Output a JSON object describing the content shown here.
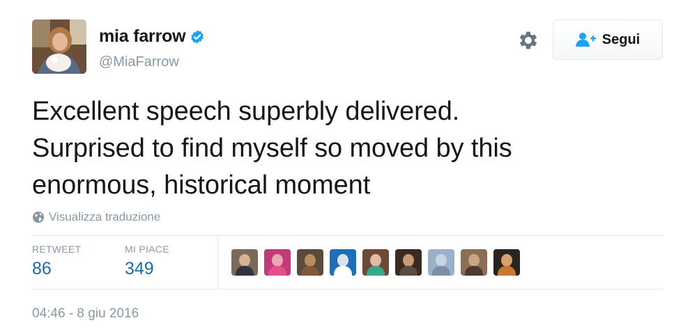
{
  "user": {
    "display_name": "mia farrow",
    "handle": "@MiaFarrow",
    "verified_icon": "verified-badge-icon",
    "verified_color": "#1da1f2"
  },
  "actions": {
    "settings_icon": "gear-icon",
    "follow_icon": "add-user-icon",
    "follow_label": "Segui"
  },
  "tweet": {
    "lines": [
      "Excellent speech superbly delivered.",
      "Surprised to find myself so moved by this",
      "enormous, historical moment"
    ],
    "translate_icon": "globe-icon",
    "translate_label": "Visualizza traduzione"
  },
  "stats": {
    "retweets_label": "RETWEET",
    "retweets_value": "86",
    "likes_label": "MI PIACE",
    "likes_value": "349"
  },
  "likers_count_shown": 9,
  "timestamp": "04:46 - 8 giu 2016",
  "colors": {
    "link_blue": "#1b6da5",
    "muted_gray": "#8899a6",
    "text_dark": "#14171a",
    "divider": "#e1e8ed"
  }
}
